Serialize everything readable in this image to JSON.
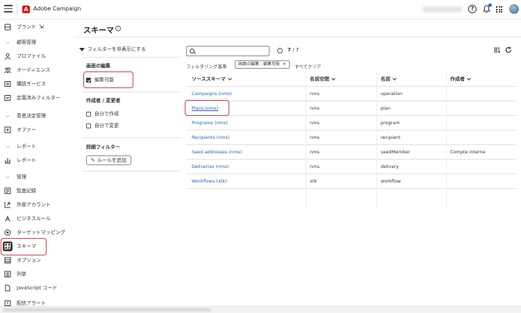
{
  "app": {
    "name": "Adobe Campaign",
    "logo_letter": "A",
    "brand_color": "#eb1000"
  },
  "topbar": {
    "icons": [
      "menu-icon",
      "help-icon",
      "bell-icon",
      "apps-grid-icon",
      "avatar"
    ],
    "help_glyph": "?",
    "notification_color": "#1473e6"
  },
  "sidebar": {
    "items": [
      {
        "label": "ブランド",
        "icon": "brand-icon",
        "kind": "item"
      },
      {
        "label": "顧客管理",
        "icon": "chevron-down-icon",
        "kind": "section"
      },
      {
        "label": "プロファイル",
        "icon": "profile-icon",
        "kind": "item"
      },
      {
        "label": "オーディエンス",
        "icon": "audience-icon",
        "kind": "item"
      },
      {
        "label": "購読サービス",
        "icon": "subscription-icon",
        "kind": "item"
      },
      {
        "label": "定義済みフィルター",
        "icon": "filter-icon",
        "kind": "item"
      },
      {
        "label": "意思決定管理",
        "icon": "chevron-down-icon",
        "kind": "section"
      },
      {
        "label": "オファー",
        "icon": "offer-icon",
        "kind": "item"
      },
      {
        "label": "レポート",
        "icon": "chevron-down-icon",
        "kind": "section"
      },
      {
        "label": "レポート",
        "icon": "report-icon",
        "kind": "item"
      },
      {
        "label": "管理",
        "icon": "chevron-down-icon",
        "kind": "section"
      },
      {
        "label": "監査記録",
        "icon": "audit-icon",
        "kind": "item"
      },
      {
        "label": "外部アカウント",
        "icon": "external-account-icon",
        "kind": "item"
      },
      {
        "label": "ビジネスルール",
        "icon": "business-rule-icon",
        "kind": "item"
      },
      {
        "label": "ターゲットマッピング",
        "icon": "target-mapping-icon",
        "kind": "item"
      },
      {
        "label": "スキーマ",
        "icon": "schema-icon",
        "kind": "item",
        "active": true
      },
      {
        "label": "オプション",
        "icon": "options-icon",
        "kind": "item"
      },
      {
        "label": "列挙",
        "icon": "enumeration-icon",
        "kind": "item"
      },
      {
        "label": "JavaScript コード",
        "icon": "javascript-icon",
        "kind": "item"
      },
      {
        "label": "配信アラート",
        "icon": "alert-icon",
        "kind": "item"
      }
    ]
  },
  "page": {
    "title": "スキーマ"
  },
  "filters": {
    "toggle_label": "フィルターを非表示にする",
    "edit_section": "画面の編集",
    "editable_label": "編集可能",
    "editable_checked": true,
    "author_section": "作成者 / 変更者",
    "created_by_me": "自分で作成",
    "modified_by_me": "自分で変更",
    "advanced_section": "詳細フィルター",
    "add_rule": "ルールを追加"
  },
  "toolbar": {
    "search_placeholder": "",
    "count_current": "7",
    "count_total": "/ 7"
  },
  "criteria": {
    "label": "フィルタリング基準",
    "chip": "画面の編集 : 編集可能",
    "clear_all": "すべてクリア"
  },
  "table": {
    "headers": [
      "ソーススキーマ",
      "名前空間",
      "名前",
      "作成者"
    ],
    "rows": [
      {
        "source": "Campaigns (nms)",
        "namespace": "nms",
        "name": "operation",
        "author": ""
      },
      {
        "source": "Plans (nms)",
        "namespace": "nms",
        "name": "plan",
        "author": ""
      },
      {
        "source": "Programs (nms)",
        "namespace": "nms",
        "name": "program",
        "author": ""
      },
      {
        "source": "Recipients (nms)",
        "namespace": "nms",
        "name": "recipient",
        "author": ""
      },
      {
        "source": "Seed addresses (nms)",
        "namespace": "nms",
        "name": "seedMember",
        "author": "Compte interne"
      },
      {
        "source": "Deliveries (nms)",
        "namespace": "nms",
        "name": "delivery",
        "author": ""
      },
      {
        "source": "Workflows (xtk)",
        "namespace": "xtk",
        "name": "workflow",
        "author": ""
      }
    ]
  },
  "colors": {
    "highlight": "#d7373f",
    "link": "#1f5fb0"
  }
}
